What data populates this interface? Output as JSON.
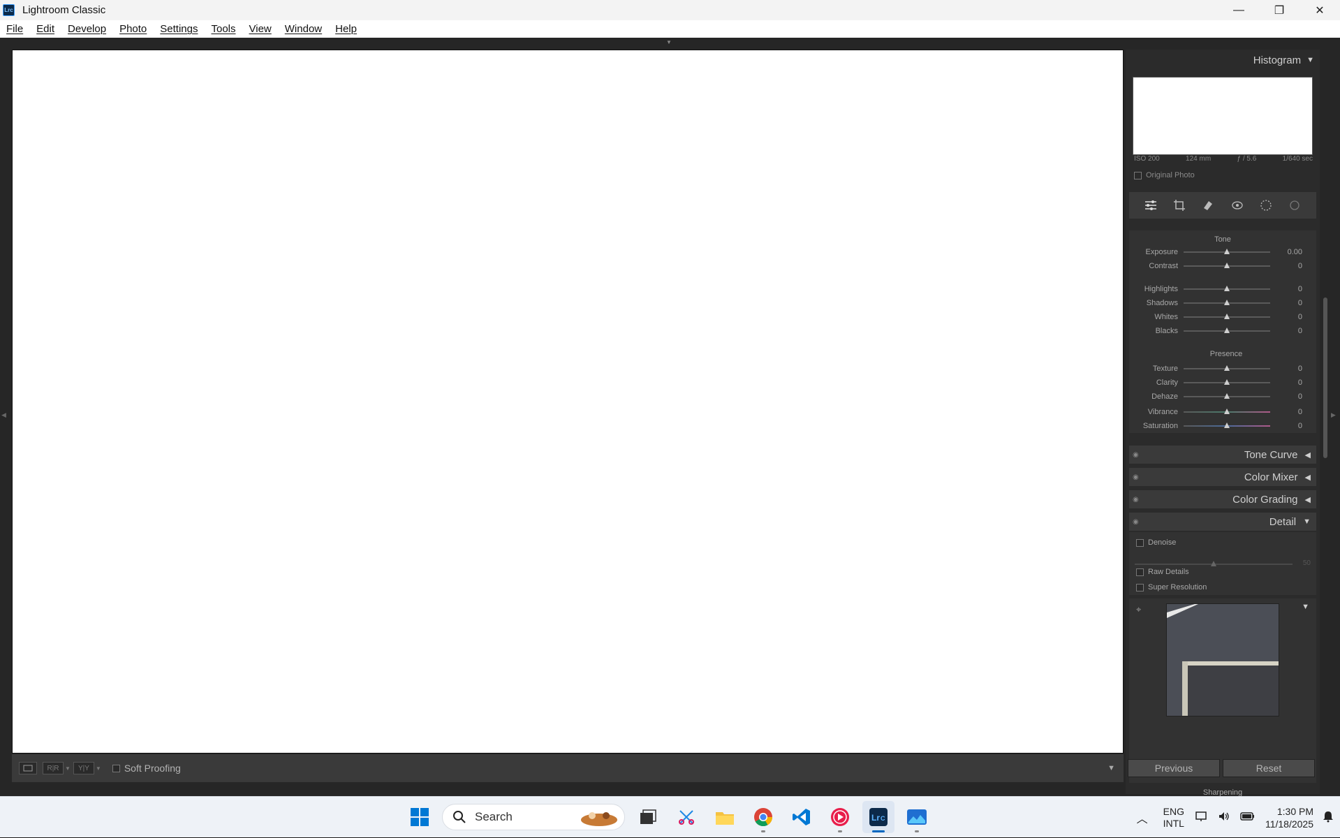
{
  "app": {
    "title": "Lightroom Classic",
    "logo_text": "Lrc"
  },
  "window_controls": {
    "minimize": "—",
    "maximize": "❐",
    "close": "✕"
  },
  "menu": [
    "File",
    "Edit",
    "Develop",
    "Photo",
    "Settings",
    "Tools",
    "View",
    "Window",
    "Help"
  ],
  "toolbar": {
    "soft_proofing_label": "Soft Proofing",
    "view_btn_1": "",
    "view_btn_2": "R|R",
    "view_btn_3": "Y|Y"
  },
  "histogram": {
    "title": "Histogram",
    "exif": {
      "iso": "ISO 200",
      "focal": "124 mm",
      "aperture": "ƒ / 5.6",
      "shutter": "1/640 sec"
    },
    "original_photo_label": "Original Photo"
  },
  "basic": {
    "tone_label": "Tone",
    "presence_label": "Presence",
    "sliders": [
      {
        "label": "Exposure",
        "value": "0.00"
      },
      {
        "label": "Contrast",
        "value": "0"
      },
      {
        "label": "Highlights",
        "value": "0"
      },
      {
        "label": "Shadows",
        "value": "0"
      },
      {
        "label": "Whites",
        "value": "0"
      },
      {
        "label": "Blacks",
        "value": "0"
      },
      {
        "label": "Texture",
        "value": "0"
      },
      {
        "label": "Clarity",
        "value": "0"
      },
      {
        "label": "Dehaze",
        "value": "0"
      },
      {
        "label": "Vibrance",
        "value": "0"
      },
      {
        "label": "Saturation",
        "value": "0"
      }
    ]
  },
  "panels": {
    "tone_curve": "Tone Curve",
    "color_mixer": "Color Mixer",
    "color_grading": "Color Grading",
    "detail": "Detail"
  },
  "detail": {
    "denoise": "Denoise",
    "denoise_value": "50",
    "raw_details": "Raw Details",
    "super_resolution": "Super Resolution",
    "sharpening": "Sharpening"
  },
  "buttons": {
    "previous": "Previous",
    "reset": "Reset"
  },
  "taskbar": {
    "search": "Search",
    "lang_top": "ENG",
    "lang_bottom": "INTL",
    "time": "1:30 PM",
    "date": "11/18/2025"
  }
}
